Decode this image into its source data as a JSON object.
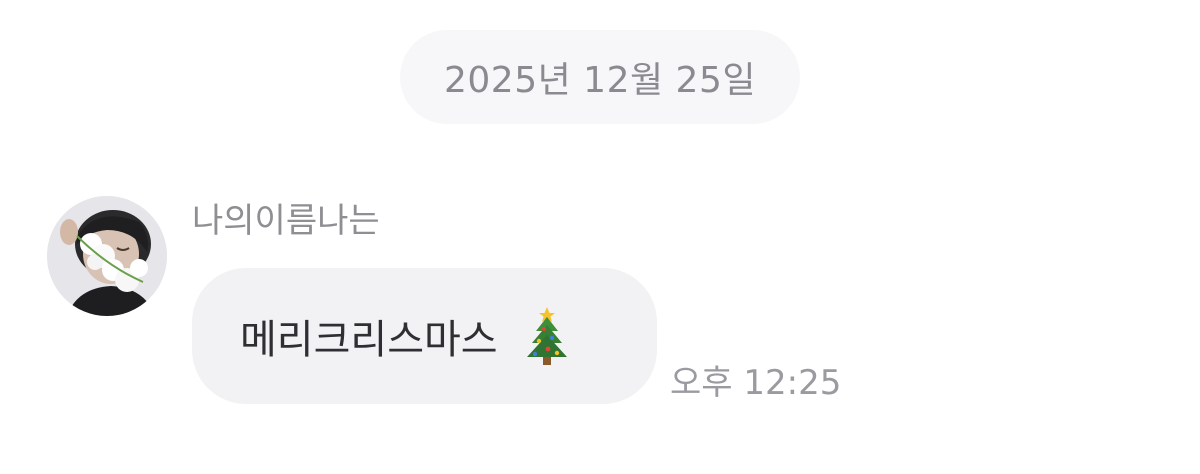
{
  "date_divider": {
    "label": "2025년 12월 25일"
  },
  "message": {
    "sender_name": "나의이름나는",
    "text": "메리크리스마스",
    "emoji_icon": "christmas-tree-icon",
    "time": "오후 12:25"
  },
  "colors": {
    "date_pill_bg": "#f7f7fa",
    "bubble_bg": "#f2f2f5",
    "muted_text": "#8e8e93",
    "message_text": "#2f2f33"
  }
}
